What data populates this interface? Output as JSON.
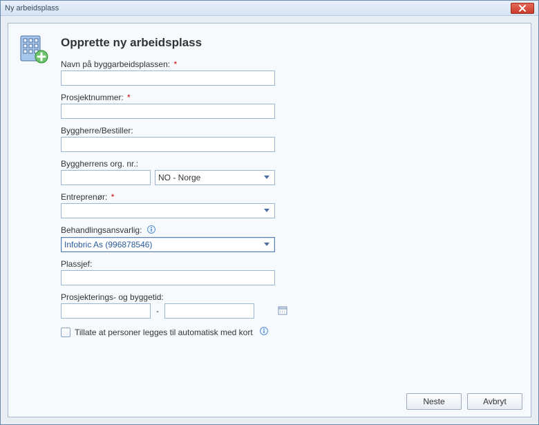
{
  "window": {
    "title": "Ny arbeidsplass"
  },
  "page": {
    "heading": "Opprette ny arbeidsplass"
  },
  "labels": {
    "site_name": "Navn på byggarbeidsplassen:",
    "project_number": "Prosjektnummer:",
    "client": "Byggherre/Bestiller:",
    "client_org": "Byggherrens org. nr.:",
    "contractor": "Entreprenør:",
    "data_controller": "Behandlingsansvarlig:",
    "site_manager": "Plassjef:",
    "period": "Prosjekterings- og byggetid:",
    "allow_auto_card": "Tillate at personer legges til automatisk med kort"
  },
  "values": {
    "site_name": "",
    "project_number": "",
    "client": "",
    "client_org_no": "",
    "client_country": "NO - Norge",
    "contractor": "",
    "data_controller": "Infobric As (996878546)",
    "site_manager": "",
    "period_from": "",
    "period_to": "",
    "allow_auto_card_checked": false
  },
  "required": {
    "site_name": true,
    "project_number": true,
    "contractor": true
  },
  "footer": {
    "next": "Neste",
    "cancel": "Avbryt"
  },
  "req_marker": "*",
  "sep": "-"
}
